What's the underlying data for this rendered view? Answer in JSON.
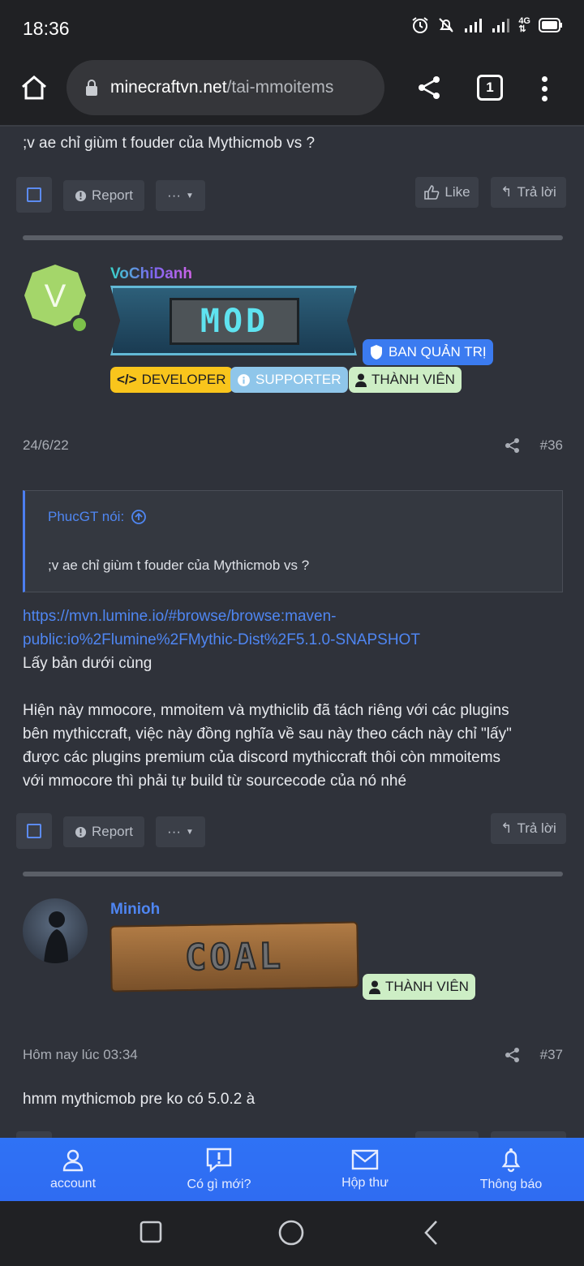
{
  "status_bar": {
    "time": "18:36"
  },
  "browser": {
    "url_domain": "minecraftvn.net",
    "url_path": "/tai-mmoitems",
    "tab_count": "1"
  },
  "previous_post": {
    "text": ";v ae chỉ giùm t fouder của Mythicmob vs ?",
    "report_label": "Report",
    "more_label": "···",
    "like_label": "Like",
    "reply_label": "Trả lời"
  },
  "post36": {
    "avatar_letter": "V",
    "username": "VoChiDanh",
    "rank_banner": "MOD",
    "badges": {
      "admin": "BAN QUẢN TRỊ",
      "developer": "DEVELOPER",
      "supporter": "SUPPORTER",
      "member": "THÀNH VIÊN"
    },
    "date": "24/6/22",
    "number": "#36",
    "quote_author": "PhucGT nói:",
    "quote_text": ";v ae chỉ giùm t fouder của Mythicmob vs ?",
    "link_line1": "https://mvn.lumine.io/#browse/browse:maven-",
    "link_line2": "public:io%2Flumine%2FMythic-Dist%2F5.1.0-SNAPSHOT",
    "line_after_link": "Lấy bản dưới cùng",
    "para_line1": "Hiện này mmocore, mmoitem và mythiclib đã tách riêng với các plugins",
    "para_line2": "bên mythiccraft, việc này đồng nghĩa về sau này theo cách này chỉ \"lấy\"",
    "para_line3": "được các plugins premium của discord mythiccraft thôi còn mmoitems",
    "para_line4": "với mmocore thì phải tự build từ sourcecode của nó nhé",
    "report_label": "Report",
    "more_label": "···",
    "reply_label": "Trả lời"
  },
  "post37": {
    "username": "Minioh",
    "rank_banner": "COAL",
    "member_badge": "THÀNH VIÊN",
    "date": "Hôm nay lúc 03:34",
    "number": "#37",
    "text": "hmm mythicmob pre ko có 5.0.2 à"
  },
  "bottom_nav": [
    {
      "label": "account",
      "icon": "user-icon"
    },
    {
      "label": "Có gì mới?",
      "icon": "alert-bubble-icon"
    },
    {
      "label": "Hộp thư",
      "icon": "envelope-icon"
    },
    {
      "label": "Thông báo",
      "icon": "bell-icon"
    }
  ],
  "colors": {
    "background": "#2f323a",
    "accent": "#2f6cf2",
    "link": "#4f86f2",
    "developer_badge": "#f9c51c",
    "supporter_badge": "#8fc6ea",
    "member_badge": "#cdeec5",
    "admin_badge": "#3b7bf0"
  }
}
